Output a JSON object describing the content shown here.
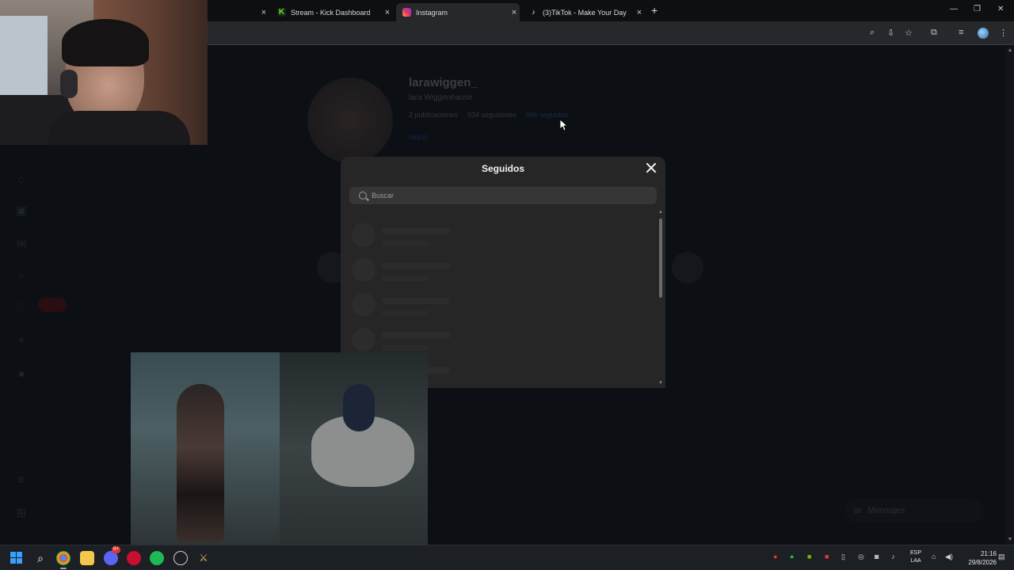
{
  "browser": {
    "tabs": [
      {
        "title": "Stream - Kick Dashboard",
        "icon": "kick-icon"
      },
      {
        "title": "Instagram",
        "icon": "instagram-icon",
        "active": true
      },
      {
        "title": "(3)TikTok - Make Your Day",
        "icon": "tiktok-icon"
      }
    ],
    "new_tab_symbol": "+",
    "close_symbol": "×"
  },
  "profile": {
    "username": "larawiggen_",
    "full_name": "lara Wiggenhause",
    "posts": "2 publicaciones",
    "followers": "934 seguidores",
    "following": "666 seguidos",
    "bio_link": "seguir"
  },
  "modal": {
    "title": "Seguidos",
    "search_placeholder": "Buscar",
    "loading_rows": 5
  },
  "messages_pill": {
    "label": "Mensajes"
  },
  "taskbar": {
    "lang_line1": "ESP",
    "lang_line2": "LAA",
    "time": "21:16",
    "date": "29/8/2026",
    "discord_badge": "9+"
  }
}
